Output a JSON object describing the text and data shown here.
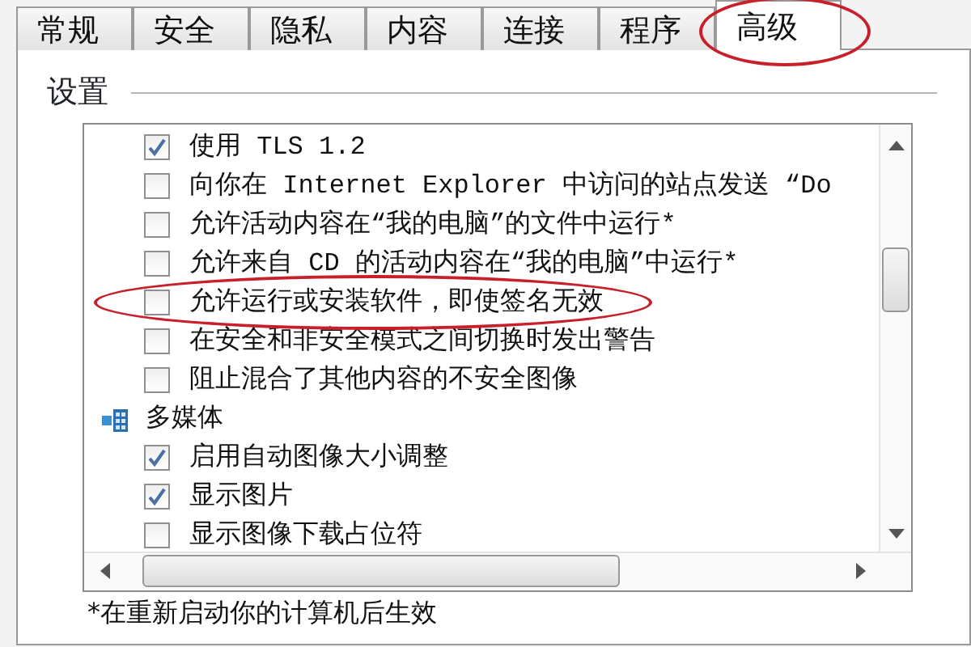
{
  "tabs": [
    {
      "label": "常规",
      "selected": false,
      "circled": false
    },
    {
      "label": "安全",
      "selected": false,
      "circled": false
    },
    {
      "label": "隐私",
      "selected": false,
      "circled": false
    },
    {
      "label": "内容",
      "selected": false,
      "circled": false
    },
    {
      "label": "连接",
      "selected": false,
      "circled": false
    },
    {
      "label": "程序",
      "selected": false,
      "circled": false
    },
    {
      "label": "高级",
      "selected": true,
      "circled": true
    }
  ],
  "settings": {
    "title": "设置",
    "items": [
      {
        "kind": "checkbox",
        "label": "使用 TLS 1.2",
        "checked": true,
        "circled": false
      },
      {
        "kind": "checkbox",
        "label": "向你在 Internet Explorer 中访问的站点发送 “Do",
        "checked": false,
        "circled": false
      },
      {
        "kind": "checkbox",
        "label": "允许活动内容在“我的电脑”的文件中运行*",
        "checked": false,
        "circled": false
      },
      {
        "kind": "checkbox",
        "label": "允许来自 CD 的活动内容在“我的电脑”中运行*",
        "checked": false,
        "circled": false
      },
      {
        "kind": "checkbox",
        "label": "允许运行或安装软件，即使签名无效",
        "checked": false,
        "circled": true
      },
      {
        "kind": "checkbox",
        "label": "在安全和非安全模式之间切换时发出警告",
        "checked": false,
        "circled": false
      },
      {
        "kind": "checkbox",
        "label": "阻止混合了其他内容的不安全图像",
        "checked": false,
        "circled": false
      },
      {
        "kind": "category",
        "label": "多媒体",
        "circled": false
      },
      {
        "kind": "checkbox",
        "label": "启用自动图像大小调整",
        "checked": true,
        "circled": false
      },
      {
        "kind": "checkbox",
        "label": "显示图片",
        "checked": true,
        "circled": false
      },
      {
        "kind": "checkbox",
        "label": "显示图像下载占位符",
        "checked": false,
        "circled": false
      }
    ]
  },
  "footnote": "*在重新启动你的计算机后生效"
}
